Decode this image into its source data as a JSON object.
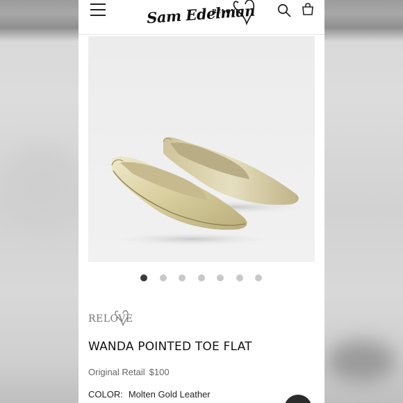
{
  "header": {
    "brand_script": "Sam Edelman",
    "brand_tag": "RELOVE",
    "menu_icon": "hamburger-icon",
    "search_icon": "search-icon",
    "cart_icon": "shopping-bag-icon"
  },
  "gallery": {
    "image_alt": "Metallic gold pointed toe flats",
    "slide_count": 7,
    "active_slide": 1
  },
  "product": {
    "brand_badge": "RELOVE",
    "title": "WANDA POINTED TOE FLAT",
    "original_retail_label": "Original Retail",
    "original_retail_value": "$100",
    "color_label": "COLOR:",
    "color_value": "Molten Gold Leather"
  },
  "colors": {
    "accent": "#111111",
    "muted_text": "#666666",
    "dot_active": "#3a3a3a",
    "dot_inactive": "#c8c8c8",
    "shoe_gold": "#d8cfa6"
  }
}
